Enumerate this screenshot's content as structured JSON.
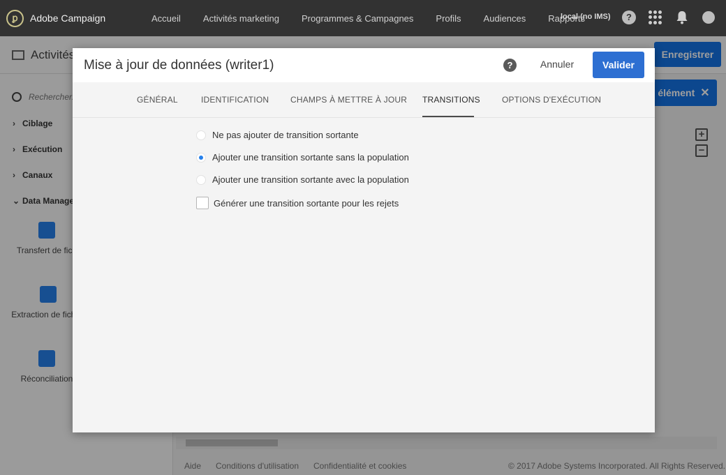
{
  "topbar": {
    "product": "Adobe Campaign",
    "nav": [
      "Accueil",
      "Activités marketing",
      "Programmes & Campagnes",
      "Profils",
      "Audiences",
      "Rapports"
    ],
    "instance": "local (no IMS)",
    "help_glyph": "?"
  },
  "page": {
    "title": "Activités",
    "save_label": "Enregistrer",
    "element_label": "élément",
    "search_placeholder": "Rechercher...",
    "categories": [
      "Ciblage",
      "Exécution",
      "Canaux",
      "Data Manage"
    ],
    "tools": [
      "Transfert de fich",
      "Extraction de fichier",
      "Réconciliation"
    ],
    "footer": {
      "help": "Aide",
      "terms": "Conditions d'utilisation",
      "privacy": "Confidentialité et cookies",
      "copyright": "© 2017 Adobe Systems Incorporated. All Rights Reserved."
    }
  },
  "dialog": {
    "title": "Mise à jour de données (writer1)",
    "help_glyph": "?",
    "cancel_label": "Annuler",
    "validate_label": "Valider",
    "tabs": [
      "GÉNÉRAL",
      "IDENTIFICATION",
      "CHAMPS À METTRE À JOUR",
      "TRANSITIONS",
      "OPTIONS D'EXÉCUTION"
    ],
    "active_tab": "TRANSITIONS",
    "options": [
      {
        "label": "Ne pas ajouter de transition sortante",
        "checked": false
      },
      {
        "label": "Ajouter une transition sortante sans la population",
        "checked": true
      },
      {
        "label": "Ajouter une transition sortante avec la population",
        "checked": false
      }
    ],
    "reject_checkbox": {
      "label": "Générer une transition sortante pour les rejets",
      "checked": false
    }
  },
  "colors": {
    "accent": "#2680eb",
    "validate": "#2d6fd2",
    "topbar": "#323232"
  }
}
